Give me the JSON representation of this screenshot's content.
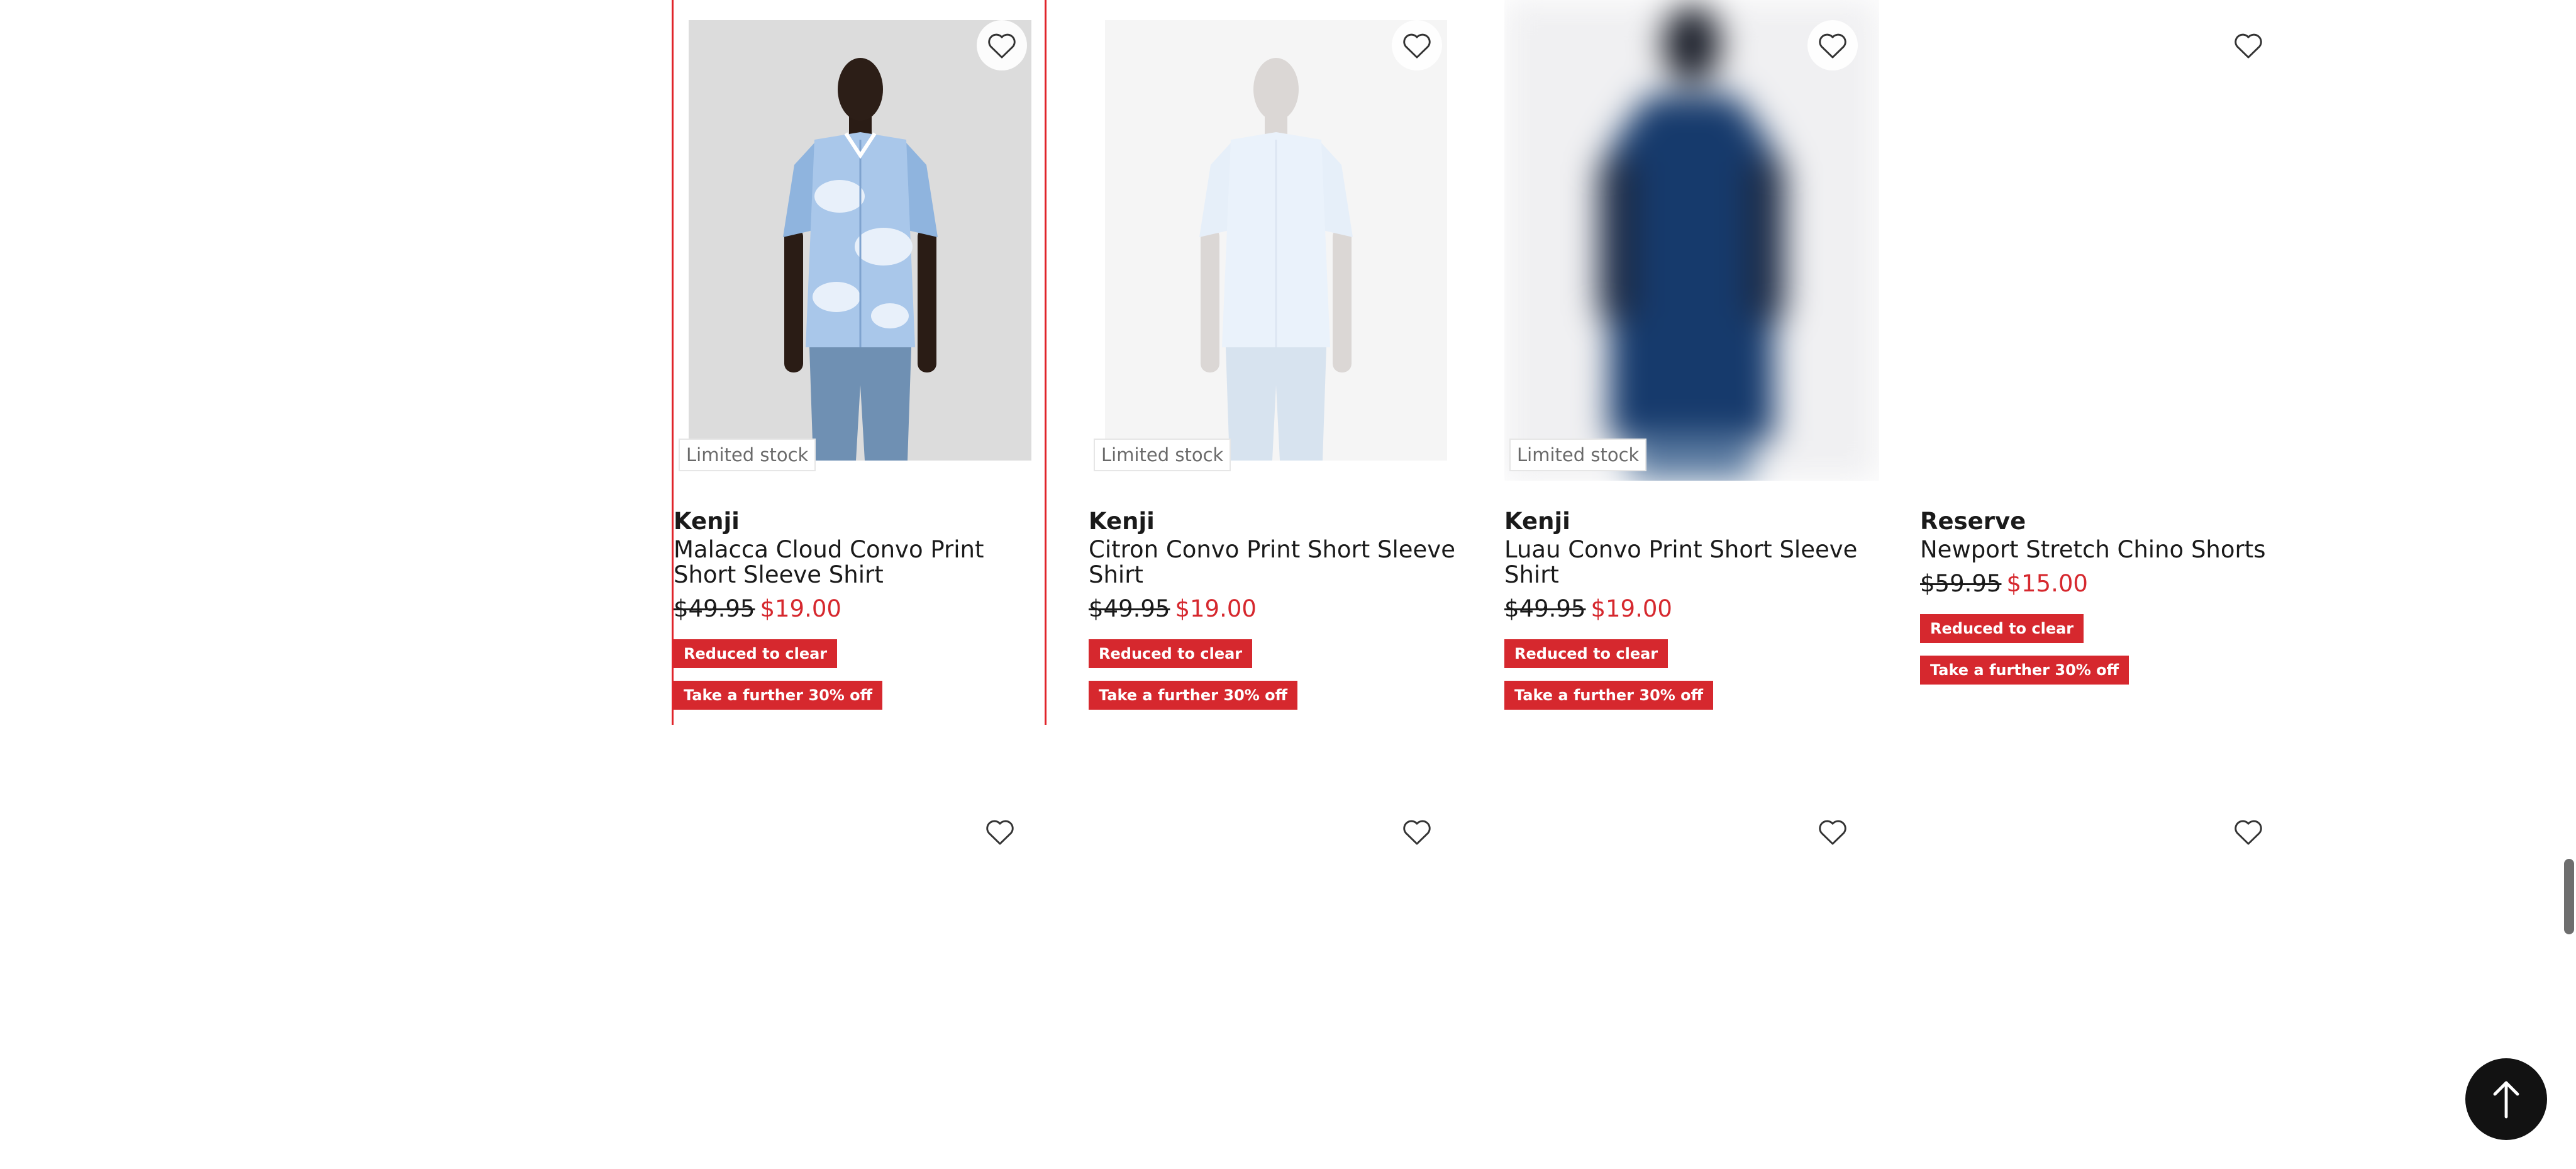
{
  "colors": {
    "sale_red": "#d6282e",
    "selected_outline": "#e0242a",
    "text_dark": "#1a1a1a",
    "tag_gray": "#6a6a6a",
    "back_to_top_bg": "#121212"
  },
  "products": [
    {
      "brand": "Kenji",
      "title": "Malacca Cloud Convo Print Short Sleeve Shirt",
      "was_price": "$49.95",
      "now_price": "$19.00",
      "stock_tag": "Limited stock",
      "promo_1": "Reduced to clear",
      "promo_2": "Take a further 30% off",
      "wishlist_icon": "heart-outline-icon",
      "image_state": "loaded",
      "selected": true
    },
    {
      "brand": "Kenji",
      "title": "Citron Convo Print Short Sleeve Shirt",
      "was_price": "$49.95",
      "now_price": "$19.00",
      "stock_tag": "Limited stock",
      "promo_1": "Reduced to clear",
      "promo_2": "Take a further 30% off",
      "wishlist_icon": "heart-outline-icon",
      "image_state": "faded"
    },
    {
      "brand": "Kenji",
      "title": "Luau Convo Print Short Sleeve Shirt",
      "was_price": "$49.95",
      "now_price": "$19.00",
      "stock_tag": "Limited stock",
      "promo_1": "Reduced to clear",
      "promo_2": "Take a further 30% off",
      "wishlist_icon": "heart-outline-icon",
      "image_state": "blurred"
    },
    {
      "brand": "Reserve",
      "title": "Newport Stretch Chino Shorts",
      "was_price": "$59.95",
      "now_price": "$15.00",
      "promo_1": "Reduced to clear",
      "promo_2": "Take a further 30% off",
      "wishlist_icon": "heart-outline-icon",
      "image_state": "not-loaded"
    }
  ],
  "next_row_wishlist_icons": [
    "heart-outline-icon",
    "heart-outline-icon",
    "heart-outline-icon",
    "heart-outline-icon"
  ],
  "back_to_top_icon": "arrow-up-icon"
}
